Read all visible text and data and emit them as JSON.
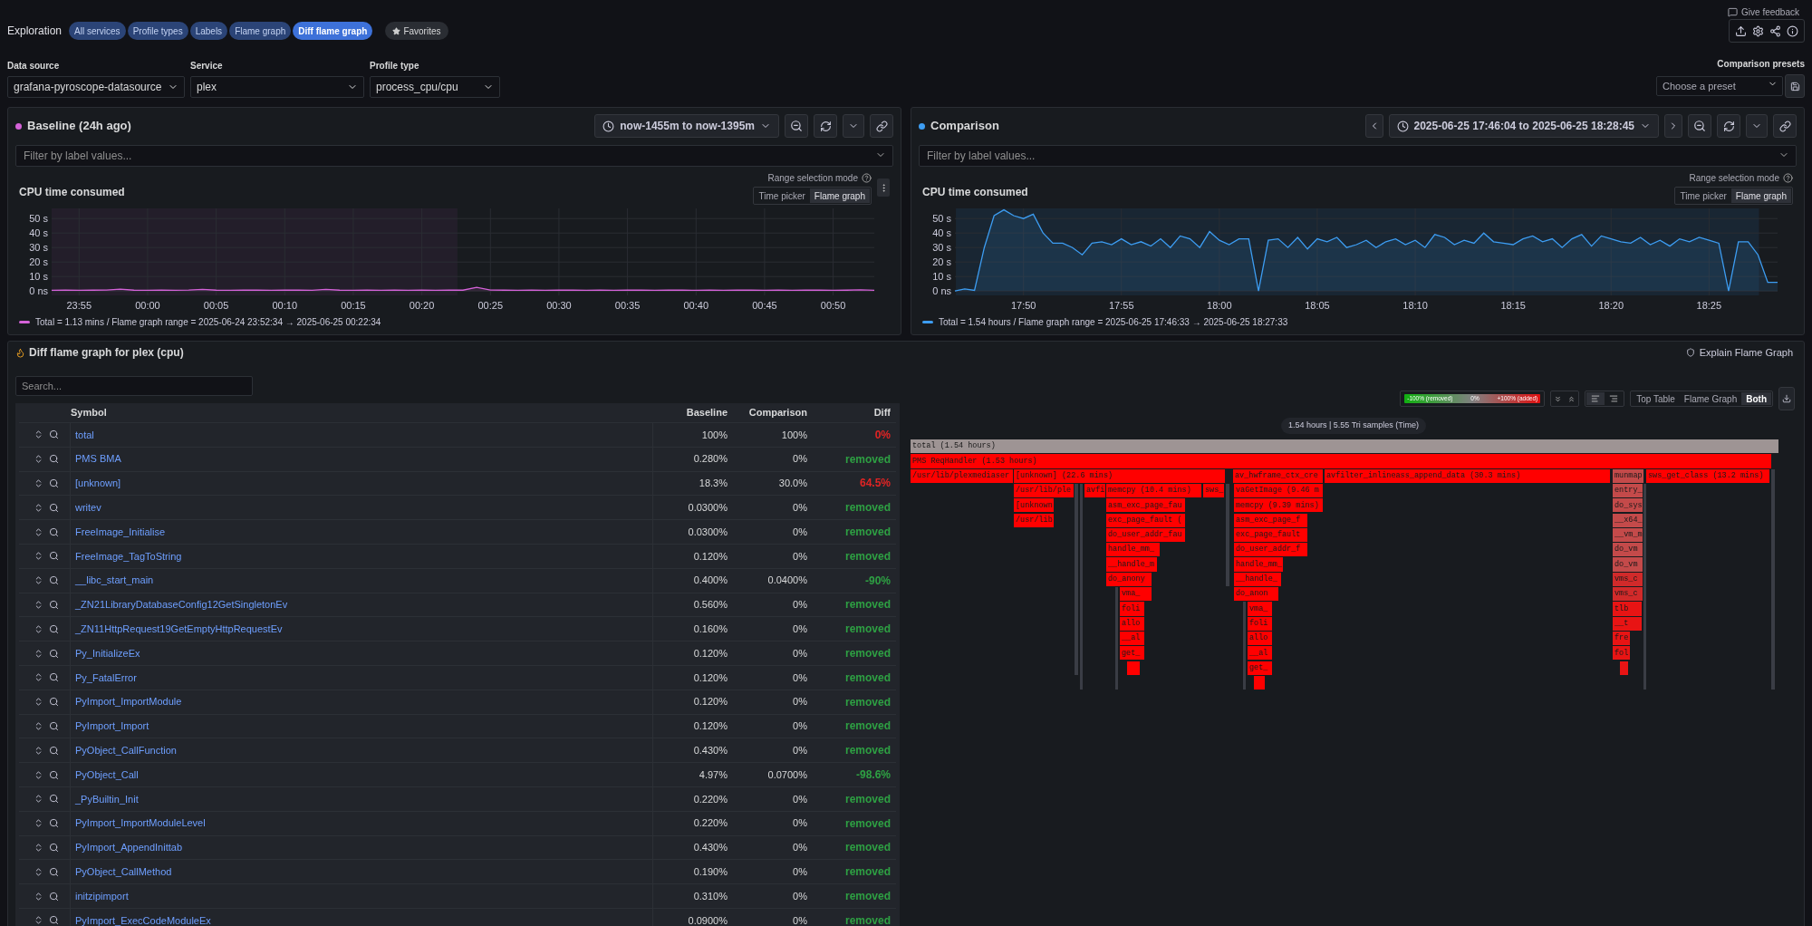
{
  "header": {
    "title": "Exploration",
    "feedback": "Give feedback",
    "favorites": "Favorites",
    "breadcrumbs": [
      {
        "label": "All services",
        "selected": false
      },
      {
        "label": "Profile types",
        "selected": false
      },
      {
        "label": "Labels",
        "selected": false
      },
      {
        "label": "Flame graph",
        "selected": false
      },
      {
        "label": "Diff flame graph",
        "selected": true
      }
    ]
  },
  "controls": {
    "data_source": {
      "label": "Data source",
      "value": "grafana-pyroscope-datasource"
    },
    "service": {
      "label": "Service",
      "value": "plex"
    },
    "profile_type": {
      "label": "Profile type",
      "value": "process_cpu/cpu"
    },
    "presets": {
      "label": "Comparison presets",
      "placeholder": "Choose a preset"
    }
  },
  "panels": [
    {
      "kind": "baseline",
      "title": "Baseline (24h ago)",
      "color": "#d462d8",
      "time_range": "now-1455m to now-1395m",
      "filter_placeholder": "Filter by label values...",
      "chart_title": "CPU time consumed",
      "range_mode_label": "Range selection mode",
      "range_modes": [
        {
          "label": "Time picker",
          "selected": false
        },
        {
          "label": "Flame graph",
          "selected": true
        }
      ],
      "legend": "= 1.13 mins / Flame graph range = 2025-06-24 23:52:34 → 2025-06-25 00:22:34",
      "chart_data": {
        "type": "area",
        "ylim": [
          -3,
          57
        ],
        "categories": [
          null,
          null,
          "23:55",
          null,
          null,
          null,
          null,
          "00:00",
          null,
          null,
          null,
          null,
          "00:05",
          null,
          null,
          null,
          null,
          "00:10",
          null,
          null,
          null,
          null,
          "00:15",
          null,
          null,
          null,
          null,
          "00:20",
          null,
          null,
          null,
          null,
          "00:25",
          null,
          null,
          null,
          null,
          "00:30",
          null,
          null,
          null,
          null,
          "00:35",
          null,
          null,
          null,
          null,
          "00:40",
          null,
          null,
          null,
          null,
          "00:45",
          null,
          null,
          null,
          null,
          "00:50",
          null,
          null,
          null
        ],
        "series": [
          {
            "name": "Total",
            "color": "#d462d8",
            "values": [
              0.5,
              0.6,
              0.5,
              0.6,
              0.7,
              1.3,
              0.6,
              0.5,
              0.6,
              0.5,
              0.7,
              1.2,
              0.6,
              0.5,
              0.6,
              0.6,
              0.5,
              0.7,
              0.6,
              0.5,
              1.1,
              0.6,
              0.5,
              0.6,
              0.5,
              0.6,
              0.5,
              0.6,
              0.5,
              0.6,
              0.6,
              2.5,
              0.7,
              0.6,
              0.5,
              0.6,
              0.5,
              0.6,
              0.7,
              0.5,
              0.6,
              0.5,
              0.6,
              0.6,
              0.5,
              0.7,
              0.6,
              0.5,
              0.6,
              0.5,
              0.6,
              0.7,
              0.5,
              0.6,
              0.5,
              0.6,
              0.6,
              0.5,
              0.6,
              0.8,
              0.5
            ]
          }
        ],
        "yticks": [
          {
            "value": 0,
            "label": "0 ns"
          },
          {
            "value": 10,
            "label": "10 s"
          },
          {
            "value": 20,
            "label": "20 s"
          },
          {
            "value": 30,
            "label": "30 s"
          },
          {
            "value": 40,
            "label": "40 s"
          },
          {
            "value": 50,
            "label": "50 s"
          }
        ],
        "grid": true
      }
    },
    {
      "kind": "comparison",
      "title": "Comparison",
      "color": "#3d9df2",
      "time_range": "2025-06-25 17:46:04 to 2025-06-25 18:28:45",
      "filter_placeholder": "Filter by label values...",
      "chart_title": "CPU time consumed",
      "range_mode_label": "Range selection mode",
      "range_modes": [
        {
          "label": "Time picker",
          "selected": false
        },
        {
          "label": "Flame graph",
          "selected": true
        }
      ],
      "legend": "= 1.54 hours / Flame graph range = 2025-06-25 17:46:33 → 2025-06-25 18:27:33",
      "chart_data": {
        "type": "area",
        "ylim": [
          -3,
          57
        ],
        "categories": [
          null,
          null,
          null,
          null,
          null,
          null,
          null,
          "17:50",
          null,
          null,
          null,
          null,
          null,
          null,
          null,
          null,
          null,
          "17:55",
          null,
          null,
          null,
          null,
          null,
          null,
          null,
          null,
          null,
          "18:00",
          null,
          null,
          null,
          null,
          null,
          null,
          null,
          null,
          null,
          "18:05",
          null,
          null,
          null,
          null,
          null,
          null,
          null,
          null,
          null,
          "18:10",
          null,
          null,
          null,
          null,
          null,
          null,
          null,
          null,
          null,
          "18:15",
          null,
          null,
          null,
          null,
          null,
          null,
          null,
          null,
          null,
          "18:20",
          null,
          null,
          null,
          null,
          null,
          null,
          null,
          null,
          null,
          "18:25",
          null,
          null,
          null,
          null,
          null,
          null,
          null
        ],
        "series": [
          {
            "name": "Total",
            "color": "#3d9df2",
            "values": [
              0,
              1.5,
              0.5,
              30,
              52,
              56,
              52,
              50,
              53,
              40,
              33,
              33,
              30,
              25,
              33,
              34,
              32,
              36,
              32,
              34,
              31,
              36,
              30,
              38,
              36,
              30,
              41,
              35,
              32,
              36,
              36,
              0,
              35,
              36,
              30,
              37,
              29,
              36,
              34,
              37,
              30,
              32,
              35,
              30,
              34,
              36,
              32,
              35,
              30,
              39,
              37,
              32,
              35,
              33,
              40,
              34,
              33,
              32,
              36,
              38,
              34,
              36,
              30,
              36,
              39,
              31,
              38,
              36,
              34,
              33,
              37,
              32,
              35,
              31,
              36,
              34,
              37,
              35,
              33,
              0,
              34,
              34,
              25,
              6,
              6
            ]
          }
        ],
        "yticks": [
          {
            "value": 0,
            "label": "0 ns"
          },
          {
            "value": 10,
            "label": "10 s"
          },
          {
            "value": 20,
            "label": "20 s"
          },
          {
            "value": 30,
            "label": "30 s"
          },
          {
            "value": 40,
            "label": "40 s"
          },
          {
            "value": 50,
            "label": "50 s"
          }
        ],
        "grid": true
      }
    }
  ],
  "diff": {
    "title": "Diff flame graph for plex (cpu)",
    "explain": "Explain Flame Graph",
    "search_placeholder": "Search...",
    "legend": {
      "removed": "-100% (removed)",
      "neutral": "0%",
      "added": "+100% (added)"
    },
    "align_options": [
      {
        "kind": "left",
        "selected": true
      },
      {
        "kind": "right",
        "selected": false
      }
    ],
    "views": [
      {
        "label": "Top Table",
        "selected": false
      },
      {
        "label": "Flame Graph",
        "selected": false
      },
      {
        "label": "Both",
        "selected": true
      }
    ],
    "table": {
      "columns": [
        "Symbol",
        "Baseline",
        "Comparison",
        "Diff"
      ],
      "rows": [
        {
          "symbol": "total",
          "baseline": "100%",
          "comparison": "100%",
          "diff": "0%",
          "color": "#e02424"
        },
        {
          "symbol": "PMS BMA",
          "baseline": "0.280%",
          "comparison": "0%",
          "diff": "removed",
          "color": "#2ea043"
        },
        {
          "symbol": "[unknown]",
          "baseline": "18.3%",
          "comparison": "30.0%",
          "diff": "64.5%",
          "color": "#e02424"
        },
        {
          "symbol": "writev",
          "baseline": "0.0300%",
          "comparison": "0%",
          "diff": "removed",
          "color": "#2ea043"
        },
        {
          "symbol": "FreeImage_Initialise",
          "baseline": "0.0300%",
          "comparison": "0%",
          "diff": "removed",
          "color": "#2ea043"
        },
        {
          "symbol": "FreeImage_TagToString",
          "baseline": "0.120%",
          "comparison": "0%",
          "diff": "removed",
          "color": "#2ea043"
        },
        {
          "symbol": "__libc_start_main",
          "baseline": "0.400%",
          "comparison": "0.0400%",
          "diff": "-90%",
          "color": "#2ea043"
        },
        {
          "symbol": "_ZN21LibraryDatabaseConfig12GetSingletonEv",
          "baseline": "0.560%",
          "comparison": "0%",
          "diff": "removed",
          "color": "#2ea043"
        },
        {
          "symbol": "_ZN11HttpRequest19GetEmptyHttpRequestEv",
          "baseline": "0.160%",
          "comparison": "0%",
          "diff": "removed",
          "color": "#2ea043"
        },
        {
          "symbol": "Py_InitializeEx",
          "baseline": "0.120%",
          "comparison": "0%",
          "diff": "removed",
          "color": "#2ea043"
        },
        {
          "symbol": "Py_FatalError",
          "baseline": "0.120%",
          "comparison": "0%",
          "diff": "removed",
          "color": "#2ea043"
        },
        {
          "symbol": "PyImport_ImportModule",
          "baseline": "0.120%",
          "comparison": "0%",
          "diff": "removed",
          "color": "#2ea043"
        },
        {
          "symbol": "PyImport_Import",
          "baseline": "0.120%",
          "comparison": "0%",
          "diff": "removed",
          "color": "#2ea043"
        },
        {
          "symbol": "PyObject_CallFunction",
          "baseline": "0.430%",
          "comparison": "0%",
          "diff": "removed",
          "color": "#2ea043"
        },
        {
          "symbol": "PyObject_Call",
          "baseline": "4.97%",
          "comparison": "0.0700%",
          "diff": "-98.6%",
          "color": "#2ea043"
        },
        {
          "symbol": "_PyBuiltin_Init",
          "baseline": "0.220%",
          "comparison": "0%",
          "diff": "removed",
          "color": "#2ea043"
        },
        {
          "symbol": "PyImport_ImportModuleLevel",
          "baseline": "0.220%",
          "comparison": "0%",
          "diff": "removed",
          "color": "#2ea043"
        },
        {
          "symbol": "PyImport_AppendInittab",
          "baseline": "0.430%",
          "comparison": "0%",
          "diff": "removed",
          "color": "#2ea043"
        },
        {
          "symbol": "PyObject_CallMethod",
          "baseline": "0.190%",
          "comparison": "0%",
          "diff": "removed",
          "color": "#2ea043"
        },
        {
          "symbol": "initzipimport",
          "baseline": "0.310%",
          "comparison": "0%",
          "diff": "removed",
          "color": "#2ea043"
        },
        {
          "symbol": "PyImport_ExecCodeModuleEx",
          "baseline": "0.0900%",
          "comparison": "0%",
          "diff": "removed",
          "color": "#2ea043"
        }
      ]
    },
    "flame_graph": {
      "summary": "1.54 hours | 5.55 Tri samples (Time)",
      "root": {
        "label": "total (1.54 hours)",
        "color": "#9e9494",
        "children": [
          {
            "label": "PMS ReqHandler (1.53 hours)",
            "color": "#ff0000",
            "children": [
              {
                "label": "/usr/lib/plexmediaser",
                "color": "#ff0000"
              },
              {
                "label": "[unknown] (22.6 mins)",
                "color": "#ff0000",
                "children": [
                  {
                    "label": "/usr/lib/ple",
                    "color": "#ff0000",
                    "children": [
                      {
                        "label": "[unknown",
                        "color": "#ff0000",
                        "children": [
                          {
                            "label": "/usr/lib",
                            "color": "#ff0000"
                          }
                        ]
                      }
                    ]
                  },
                  {
                    "label": "avfi",
                    "color": "#ff0000"
                  },
                  {
                    "label": "memcpy (10.4 mins)",
                    "color": "#ff0000",
                    "children": [
                      {
                        "label": "asm_exc_page_fau",
                        "color": "#ff0000",
                        "children": [
                          {
                            "label": "exc_page_fault (",
                            "color": "#ff0000",
                            "children": [
                              {
                                "label": "do_user_addr_fau",
                                "color": "#ff0000",
                                "children": [
                                  {
                                    "label": "handle_mm_",
                                    "color": "#ff0000",
                                    "children": [
                                      {
                                        "label": "__handle_m",
                                        "color": "#ff0000",
                                        "children": [
                                          {
                                            "label": "do_anony",
                                            "color": "#ff0000",
                                            "children": [
                                              {
                                                "label": "vma_",
                                                "color": "#ff0000",
                                                "children": [
                                                  {
                                                    "label": "foli",
                                                    "color": "#ff0000",
                                                    "children": [
                                                      {
                                                        "label": "allo",
                                                        "color": "#ff0000",
                                                        "children": [
                                                          {
                                                            "label": "__al",
                                                            "color": "#ff0000",
                                                            "children": [
                                                              {
                                                                "label": "get_",
                                                                "color": "#ff0000"
                                                              }
                                                            ]
                                                          }
                                                        ]
                                                      }
                                                    ]
                                                  }
                                                ]
                                              }
                                            ]
                                          }
                                        ]
                                      }
                                    ]
                                  }
                                ]
                              }
                            ]
                          }
                        ]
                      }
                    ]
                  },
                  {
                    "label": "sws_",
                    "color": "#ff0000"
                  }
                ]
              },
              {
                "label": "av_hwframe_ctx_cre",
                "color": "#ff0000",
                "children": [
                  {
                    "label": "vaGetImage (9.46 m",
                    "color": "#ff0000",
                    "children": [
                      {
                        "label": "memcpy (9.39 mins)",
                        "color": "#ff0000",
                        "children": [
                          {
                            "label": "asm_exc_page_f",
                            "color": "#ff0000",
                            "children": [
                              {
                                "label": "exc_page_fault",
                                "color": "#ff0000",
                                "children": [
                                  {
                                    "label": "do_user_addr_f",
                                    "color": "#ff0000",
                                    "children": [
                                      {
                                        "label": "handle_mm_",
                                        "color": "#ff0000",
                                        "children": [
                                          {
                                            "label": "__handle_",
                                            "color": "#ff0000",
                                            "children": [
                                              {
                                                "label": "do_anon",
                                                "color": "#ff0000",
                                                "children": [
                                                  {
                                                    "label": "vma_",
                                                    "color": "#ff0000",
                                                    "children": [
                                                      {
                                                        "label": "foli",
                                                        "color": "#ff0000",
                                                        "children": [
                                                          {
                                                            "label": "allo",
                                                            "color": "#ff0000",
                                                            "children": [
                                                              {
                                                                "label": "__al",
                                                                "color": "#ff0000",
                                                                "children": [
                                                                  {
                                                                    "label": "get_",
                                                                    "color": "#ff0000"
                                                                  }
                                                                ]
                                                              }
                                                            ]
                                                          }
                                                        ]
                                                      }
                                                    ]
                                                  }
                                                ]
                                              }
                                            ]
                                          }
                                        ]
                                      }
                                    ]
                                  }
                                ]
                              }
                            ]
                          }
                        ]
                      }
                    ]
                  }
                ]
              },
              {
                "label": "avfilter_inlineass_append_data (30.3 mins)",
                "color": "#ff0000"
              },
              {
                "label": "munmap",
                "color": "#c44a4a",
                "children": [
                  {
                    "label": "entry_",
                    "color": "#c44a4a",
                    "children": [
                      {
                        "label": "do_sys",
                        "color": "#c44a4a",
                        "children": [
                          {
                            "label": "__x64_",
                            "color": "#c44a4a",
                            "children": [
                              {
                                "label": "__vm_m",
                                "color": "#c44a4a",
                                "children": [
                                  {
                                    "label": "do_vm",
                                    "color": "#c44a4a",
                                    "children": [
                                      {
                                        "label": "do_vm",
                                        "color": "#c44a4a",
                                        "children": [
                                          {
                                            "label": "vms_c",
                                            "color": "#d12a2a",
                                            "children": [
                                              {
                                                "label": "vms_c",
                                                "color": "#d12a2a",
                                                "children": [
                                                  {
                                                    "label": "tlb",
                                                    "color": "#e81414",
                                                    "children": [
                                                      {
                                                        "label": "__t",
                                                        "color": "#e81414",
                                                        "children": [
                                                          {
                                                            "label": "fre",
                                                            "color": "#e81414",
                                                            "children": [
                                                              {
                                                                "label": "fol",
                                                                "color": "#e81414"
                                                              }
                                                            ]
                                                          }
                                                        ]
                                                      }
                                                    ]
                                                  }
                                                ]
                                              }
                                            ]
                                          }
                                        ]
                                      }
                                    ]
                                  }
                                ]
                              }
                            ]
                          }
                        ]
                      }
                    ]
                  }
                ]
              },
              {
                "label": "sws_get_class (13.2 mins)",
                "color": "#ff0000"
              }
            ]
          }
        ]
      }
    }
  }
}
